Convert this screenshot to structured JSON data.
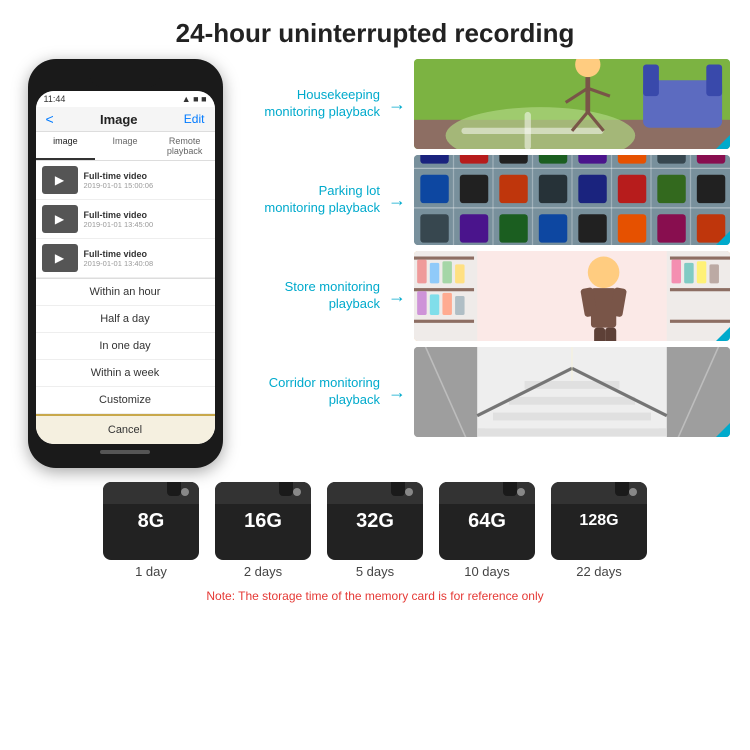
{
  "header": {
    "title": "24-hour uninterrupted recording"
  },
  "phone": {
    "status_time": "11:44",
    "nav_back": "<",
    "nav_title": "Image",
    "nav_edit": "Edit",
    "tabs": [
      "image",
      "Image",
      "Remote playback"
    ],
    "videos": [
      {
        "title": "Full-time video",
        "date": "2019-01-01 15:00:06"
      },
      {
        "title": "Full-time video",
        "date": "2019-01-01 13:45:00"
      },
      {
        "title": "Full-time video",
        "date": "2019-01-01 13:40:08"
      }
    ],
    "dropdown": [
      {
        "label": "Within an hour",
        "selected": false
      },
      {
        "label": "Half a day",
        "selected": false
      },
      {
        "label": "In one day",
        "selected": false
      },
      {
        "label": "Within a week",
        "selected": false
      },
      {
        "label": "Customize",
        "selected": false
      }
    ],
    "cancel_label": "Cancel"
  },
  "monitoring": [
    {
      "label": "Housekeeping\nmonitoring playback",
      "scene": "housekeeping"
    },
    {
      "label": "Parking lot\nmonitoring playback",
      "scene": "parking"
    },
    {
      "label": "Store monitoring\nplayback",
      "scene": "store"
    },
    {
      "label": "Corridor monitoring\nplayback",
      "scene": "corridor"
    }
  ],
  "storage": {
    "cards": [
      {
        "size": "8G",
        "days": "1 day"
      },
      {
        "size": "16G",
        "days": "2 days"
      },
      {
        "size": "32G",
        "days": "5 days"
      },
      {
        "size": "64G",
        "days": "10 days"
      },
      {
        "size": "128G",
        "days": "22 days"
      }
    ],
    "note": "Note: The storage time of the memory card is for reference only"
  }
}
